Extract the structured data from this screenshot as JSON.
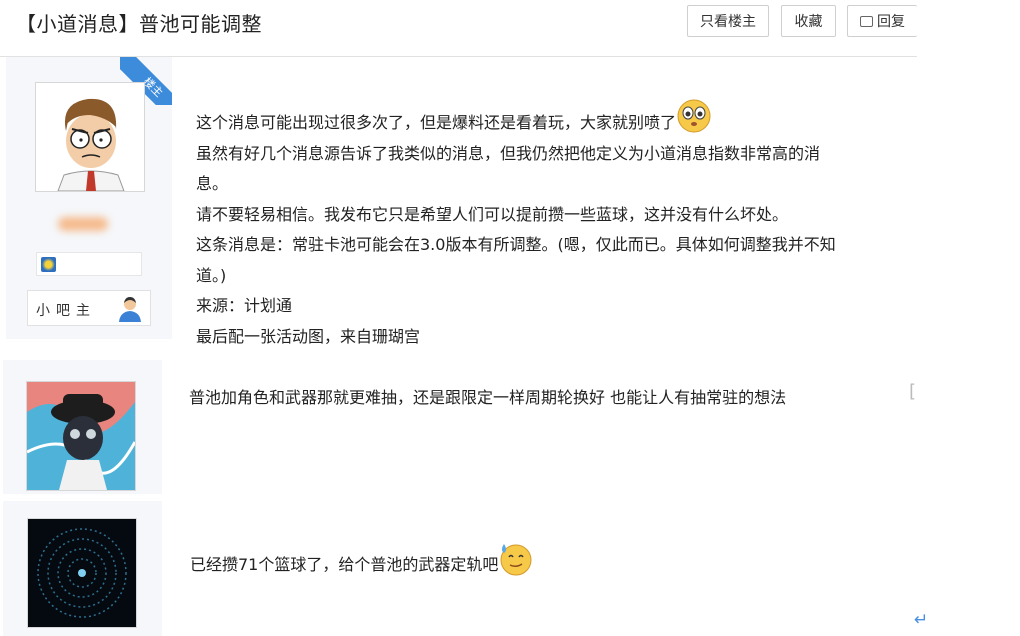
{
  "thread": {
    "title": "【小道消息】普池可能调整"
  },
  "toolbar": {
    "only_lz": "只看楼主",
    "favorite": "收藏",
    "reply": "回复"
  },
  "post1": {
    "ribbon": "楼主",
    "role": "小吧主",
    "lines": [
      "这个消息可能出现过很多次了，但是爆料还是看着玩，大家就别喷了",
      "虽然有好几个消息源告诉了我类似的消息，但我仍然把他定义为小道消息指数非常高的消",
      "息。",
      "请不要轻易相信。我发布它只是希望人们可以提前攒一些蓝球，这并没有什么坏处。",
      "这条消息是：常驻卡池可能会在3.0版本有所调整。(嗯，仅此而已。具体如何调整我并不知",
      "道。)",
      "来源：计划通",
      "最后配一张活动图，来自珊瑚宫"
    ]
  },
  "post2": {
    "text": "普池加角色和武器那就更难抽，还是跟限定一样周期轮换好 也能让人有抽常驻的想法",
    "bracket": "["
  },
  "post3": {
    "text": "已经攒71个篮球了，给个普池的武器定轨吧"
  },
  "icons": {
    "reply": "comment-icon",
    "emoji1": "teary-eyed-emoji-icon",
    "emoji2": "sweat-smile-emoji-icon",
    "badge": "level-badge-icon",
    "role": "moderator-person-icon",
    "return": "return-arrow-icon"
  }
}
